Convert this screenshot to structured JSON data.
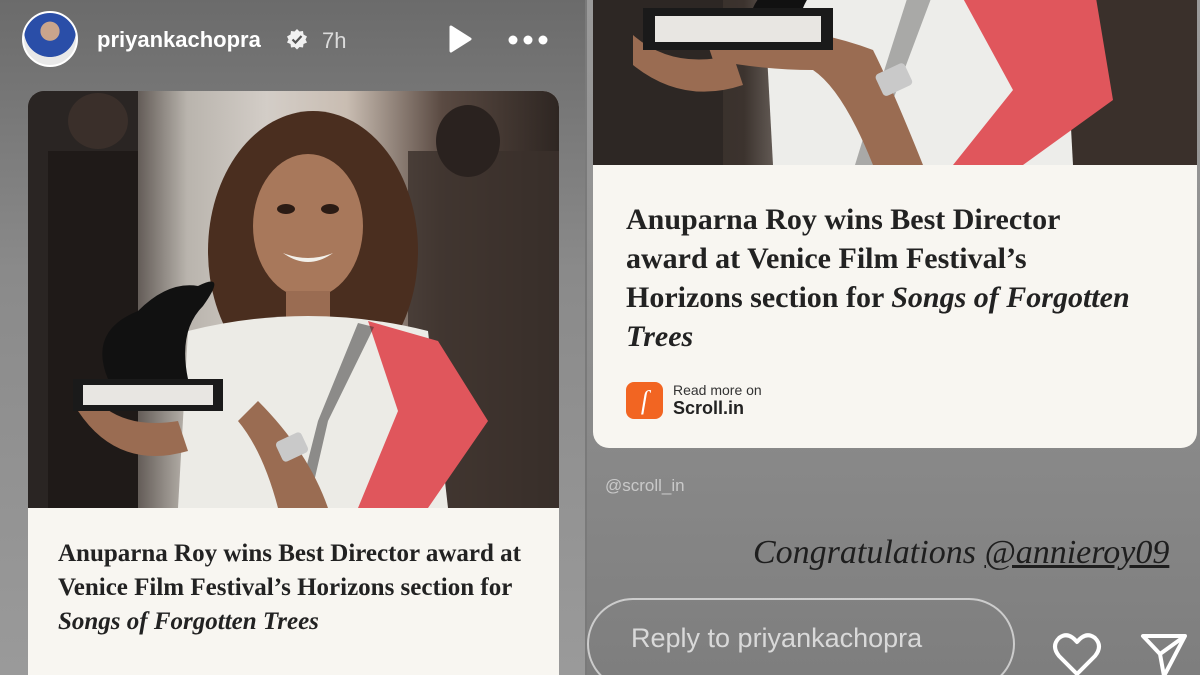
{
  "story": {
    "username": "priyankachopra",
    "timestamp": "7h",
    "icons": {
      "verified": "verified-badge-icon",
      "play": "play-icon",
      "more": "more-options-icon",
      "like": "heart-icon",
      "share": "send-icon"
    }
  },
  "left_card": {
    "headline_main": "Anuparna Roy wins Best Director award at Venice Film Festival’s Horizons section for ",
    "headline_italic": "Songs of Forgotten Trees"
  },
  "right_card": {
    "headline_main": "Anuparna Roy wins Best Director award at Venice Film Festival’s Horizons section for ",
    "headline_italic": "Songs of Forgotten Trees",
    "read_more_label": "Read more on",
    "source_name": "Scroll.in",
    "source_logo_letter": "ſ"
  },
  "mention_sticker": "@scroll_in",
  "caption": {
    "text": "Congratulations ",
    "mention": "@annieroy09"
  },
  "reply": {
    "placeholder": "Reply to priyankachopra"
  },
  "colors": {
    "accent_scroll": "#f26522",
    "card_background": "#f8f6f1",
    "saree_red": "#e0565c"
  }
}
